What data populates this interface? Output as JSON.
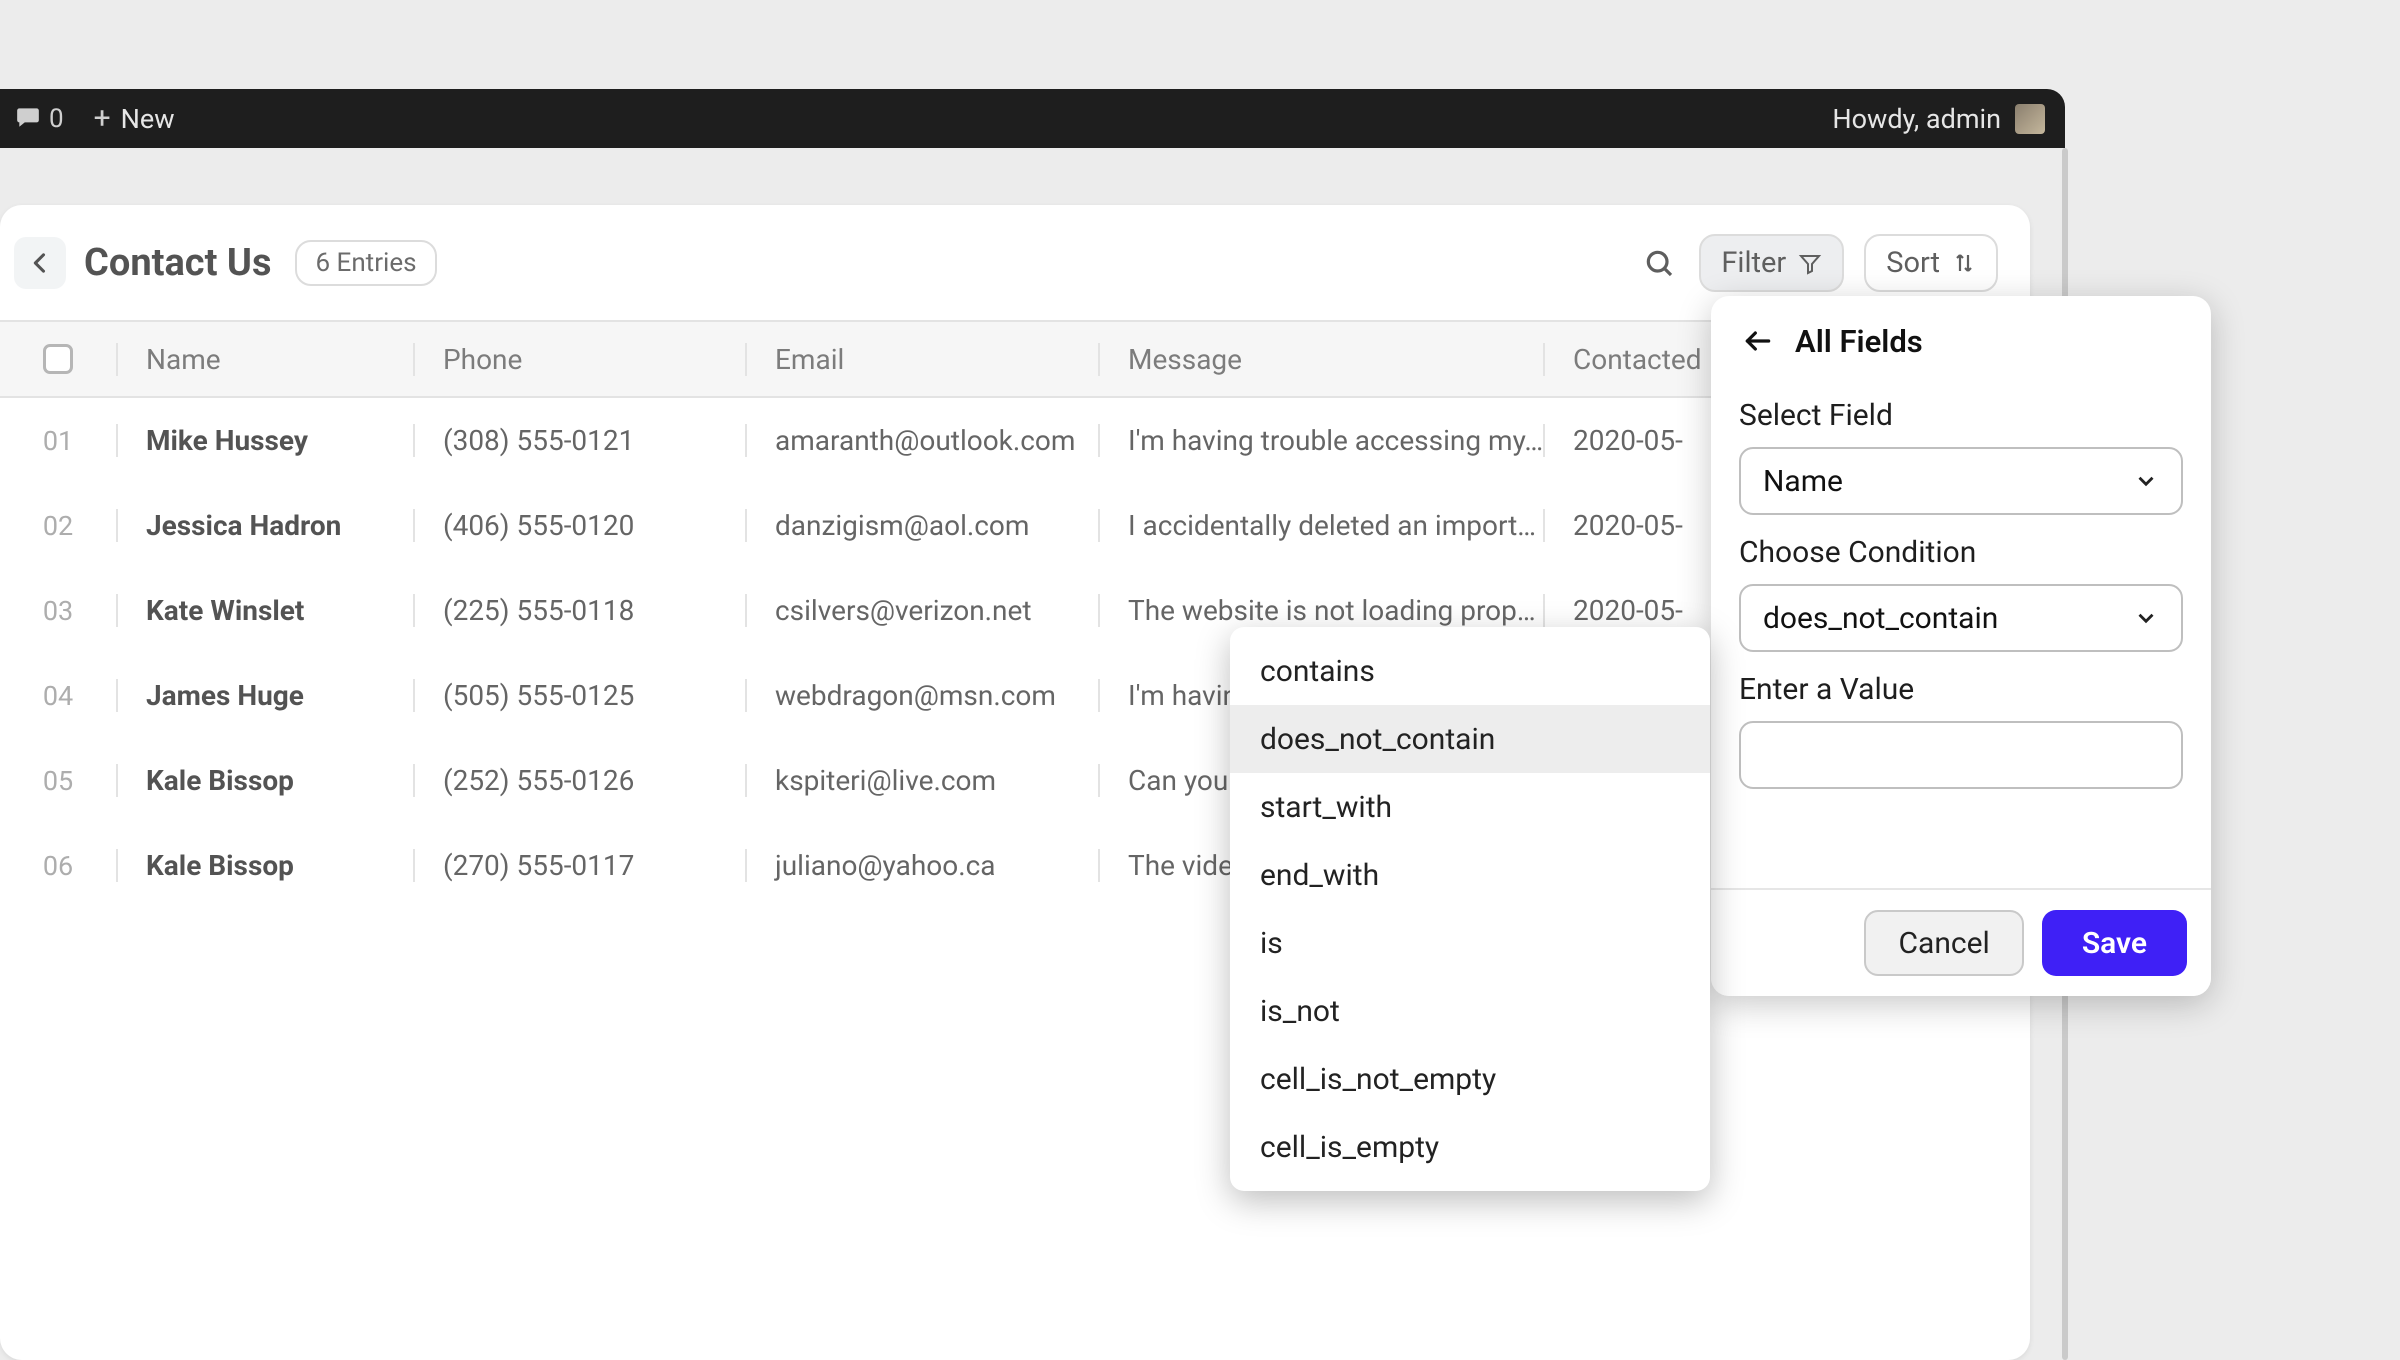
{
  "toolbar": {
    "comment_count": "0",
    "new_label": "New",
    "howdy": "Howdy, admin"
  },
  "header": {
    "title": "Contact Us",
    "entries_badge": "6 Entries",
    "filter_label": "Filter",
    "sort_label": "Sort"
  },
  "columns": {
    "name": "Name",
    "phone": "Phone",
    "email": "Email",
    "message": "Message",
    "contacted": "Contacted"
  },
  "rows": [
    {
      "num": "01",
      "name": "Mike Hussey",
      "phone": "(308) 555-0121",
      "email": "amaranth@outlook.com",
      "message": "I'm having trouble accessing my…",
      "contacted": "2020-05-"
    },
    {
      "num": "02",
      "name": "Jessica Hadron",
      "phone": "(406) 555-0120",
      "email": "danzigism@aol.com",
      "message": "I accidentally deleted an import…",
      "contacted": "2020-05-"
    },
    {
      "num": "03",
      "name": "Kate Winslet",
      "phone": "(225) 555-0118",
      "email": "csilvers@verizon.net",
      "message": "The website is not loading prop…",
      "contacted": "2020-05-"
    },
    {
      "num": "04",
      "name": "James Huge",
      "phone": "(505) 555-0125",
      "email": "webdragon@msn.com",
      "message": "I'm havin",
      "contacted": ""
    },
    {
      "num": "05",
      "name": "Kale Bissop",
      "phone": "(252) 555-0126",
      "email": "kspiteri@live.com",
      "message": "Can you",
      "contacted": ""
    },
    {
      "num": "06",
      "name": "Kale Bissop",
      "phone": "(270) 555-0117",
      "email": "juliano@yahoo.ca",
      "message": "The vide",
      "contacted": ""
    }
  ],
  "filter_panel": {
    "title": "All Fields",
    "select_field_label": "Select Field",
    "field_value": "Name",
    "condition_label": "Choose Condition",
    "condition_value": "does_not_contain",
    "value_label": "Enter a Value",
    "cancel": "Cancel",
    "save": "Save"
  },
  "condition_options": [
    "contains",
    "does_not_contain",
    "start_with",
    "end_with",
    "is",
    "is_not",
    "cell_is_not_empty",
    "cell_is_empty"
  ],
  "condition_selected_index": 1
}
